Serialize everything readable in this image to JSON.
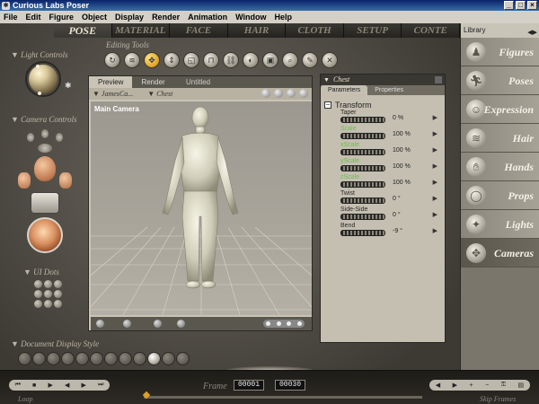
{
  "window": {
    "title": "Curious Labs Poser",
    "controls": [
      "_",
      "□",
      "×"
    ]
  },
  "menu": [
    "File",
    "Edit",
    "Figure",
    "Object",
    "Display",
    "Render",
    "Animation",
    "Window",
    "Help"
  ],
  "rooms": [
    {
      "label": "POSE",
      "active": true
    },
    {
      "label": "MATERIAL"
    },
    {
      "label": "FACE"
    },
    {
      "label": "HAIR"
    },
    {
      "label": "CLOTH"
    },
    {
      "label": "SETUP"
    },
    {
      "label": "CONTE"
    }
  ],
  "editing_tools": {
    "label": "Editing Tools",
    "tools": [
      "rotate-icon",
      "twist-icon",
      "translate-icon",
      "translate-in-out-icon",
      "scale-icon",
      "taper-icon",
      "chain-break-icon",
      "color-icon",
      "grouping-icon",
      "view-magnifier-icon",
      "morphing-icon",
      "direct-manipulation-icon"
    ],
    "active_index": 2
  },
  "left_panel": {
    "light_controls_label": "Light Controls",
    "camera_controls_label": "Camera Controls",
    "ui_dots_label": "UI Dots",
    "doc_display_style_label": "Document Display Style"
  },
  "document": {
    "tabs": [
      "Preview",
      "Render"
    ],
    "title": "Untitled",
    "figure_menu": "JamesCa...",
    "part_menu": "Chest",
    "camera_label": "Main Camera"
  },
  "parameters": {
    "header": "Chest",
    "tabs": [
      "Parameters",
      "Properties"
    ],
    "group": "Transform",
    "rows": [
      {
        "label": "Taper",
        "value": "0 %",
        "color": "default"
      },
      {
        "label": "Scale",
        "value": "100 %",
        "color": "green"
      },
      {
        "label": "xScale",
        "value": "100 %",
        "color": "green"
      },
      {
        "label": "yScale",
        "value": "100 %",
        "color": "green"
      },
      {
        "label": "zScale",
        "value": "100 %",
        "color": "green"
      },
      {
        "label": "Twist",
        "value": "0 °",
        "color": "default"
      },
      {
        "label": "Side-Side",
        "value": "0 °",
        "color": "default"
      },
      {
        "label": "Bend",
        "value": "-9 °",
        "color": "default"
      }
    ]
  },
  "library": {
    "title": "Library",
    "items": [
      {
        "label": "Figures",
        "icon": "figure-icon"
      },
      {
        "label": "Poses",
        "icon": "pose-icon"
      },
      {
        "label": "Expression",
        "icon": "expression-icon"
      },
      {
        "label": "Hair",
        "icon": "hair-icon"
      },
      {
        "label": "Hands",
        "icon": "hand-icon"
      },
      {
        "label": "Props",
        "icon": "prop-icon"
      },
      {
        "label": "Lights",
        "icon": "light-icon"
      },
      {
        "label": "Cameras",
        "icon": "camera-icon",
        "active": true
      }
    ]
  },
  "timeline": {
    "frame_label": "Frame",
    "current_frame": "00001",
    "total_frames": "00030",
    "loop_label": "Loop",
    "skip_frames_label": "Skip Frames"
  },
  "colors": {
    "accent": "#e0a020",
    "title_bar": "#0a246a",
    "green_param": "#68c048"
  }
}
